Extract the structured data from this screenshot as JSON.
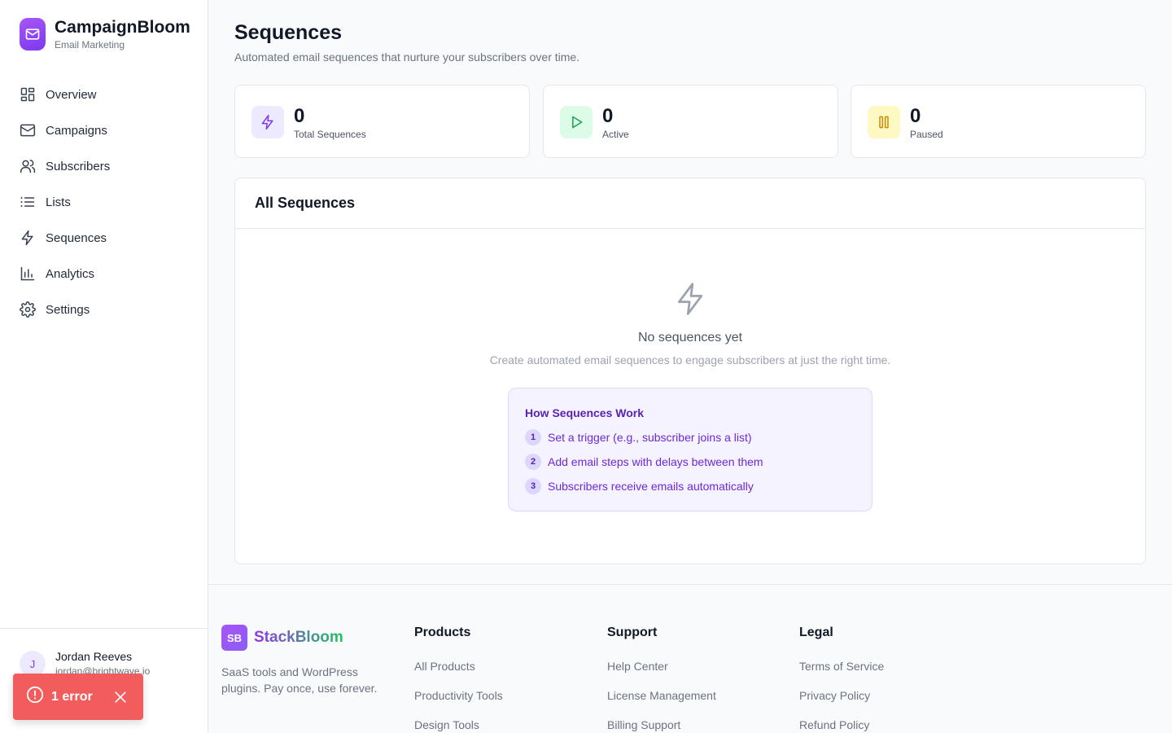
{
  "brand": {
    "name": "CampaignBloom",
    "subtitle": "Email Marketing",
    "accent": "#8b5cf6"
  },
  "sidebar": {
    "items": [
      {
        "label": "Overview",
        "icon": "grid-icon"
      },
      {
        "label": "Campaigns",
        "icon": "mail-icon"
      },
      {
        "label": "Subscribers",
        "icon": "users-icon"
      },
      {
        "label": "Lists",
        "icon": "list-icon"
      },
      {
        "label": "Sequences",
        "icon": "zap-icon"
      },
      {
        "label": "Analytics",
        "icon": "bar-chart-icon"
      },
      {
        "label": "Settings",
        "icon": "gear-icon"
      }
    ]
  },
  "user": {
    "initial": "J",
    "name": "Jordan Reeves",
    "email": "jordan@brightwave.io"
  },
  "error_toast": {
    "label": "1 error",
    "color": "#f25c5c"
  },
  "page": {
    "title": "Sequences",
    "subtitle": "Automated email sequences that nurture your subscribers over time."
  },
  "stats": [
    {
      "value": "0",
      "label": "Total Sequences",
      "icon": "zap-icon",
      "color": "#7c3aed"
    },
    {
      "value": "0",
      "label": "Active",
      "icon": "play-icon",
      "color": "#16a34a"
    },
    {
      "value": "0",
      "label": "Paused",
      "icon": "pause-icon",
      "color": "#ca8a04"
    }
  ],
  "panel": {
    "title": "All Sequences",
    "empty_title": "No sequences yet",
    "empty_subtitle": "Create automated email sequences to engage subscribers at just the right time.",
    "how": {
      "title": "How Sequences Work",
      "steps": [
        {
          "num": "1",
          "text": "Set a trigger (e.g., subscriber joins a list)"
        },
        {
          "num": "2",
          "text": "Add email steps with delays between them"
        },
        {
          "num": "3",
          "text": "Subscribers receive emails automatically"
        }
      ]
    }
  },
  "footer": {
    "logo": "SB",
    "name": "StackBloom",
    "description": "SaaS tools and WordPress plugins. Pay once, use forever.",
    "columns": [
      {
        "title": "Products",
        "links": [
          "All Products",
          "Productivity Tools",
          "Design Tools"
        ]
      },
      {
        "title": "Support",
        "links": [
          "Help Center",
          "License Management",
          "Billing Support"
        ]
      },
      {
        "title": "Legal",
        "links": [
          "Terms of Service",
          "Privacy Policy",
          "Refund Policy"
        ]
      }
    ]
  }
}
